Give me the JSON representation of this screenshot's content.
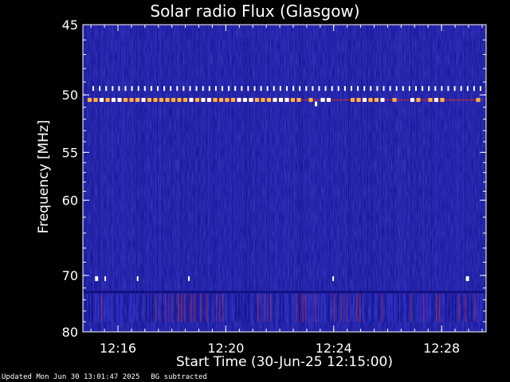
{
  "chart_data": {
    "type": "heatmap",
    "title": "Solar radio Flux (Glasgow)",
    "xlabel": "Start Time (30-Jun-25 12:15:00)",
    "ylabel": "Frequency [MHz]",
    "x_ticks": [
      {
        "minutes": 1,
        "label": "12:16"
      },
      {
        "minutes": 5,
        "label": "12:20"
      },
      {
        "minutes": 9,
        "label": "12:24"
      },
      {
        "minutes": 13,
        "label": "12:28"
      }
    ],
    "xlim_minutes": [
      -0.3,
      14.65
    ],
    "y_ticks": [
      45,
      50,
      55,
      60,
      70,
      80
    ],
    "ylim": [
      45,
      80
    ],
    "y_scale": "reciprocal",
    "colors": {
      "background": "#1a1aa0",
      "noise_light": "#3a3ad8",
      "noise_dark": "#0d0d7a",
      "hot": "#ffffff",
      "warm": "#ffb347",
      "red": "#c83030"
    },
    "features": [
      {
        "name": "rfi-49MHz",
        "freq_mhz": 49.5,
        "color": "#ffffff"
      },
      {
        "name": "rfi-50.5MHz",
        "freq_mhz": 50.4,
        "color": "#ffb347"
      },
      {
        "name": "rfi-70MHz",
        "freq_mhz": 70.5,
        "color": "#ffffff"
      },
      {
        "name": "rfi-band-73-78MHz",
        "freq_range_mhz": [
          73,
          78
        ],
        "color": "#c83030"
      }
    ]
  },
  "footer": {
    "updated": "Updated Mon Jun 30 13:01:47 2025",
    "bg": "BG subtracted"
  }
}
